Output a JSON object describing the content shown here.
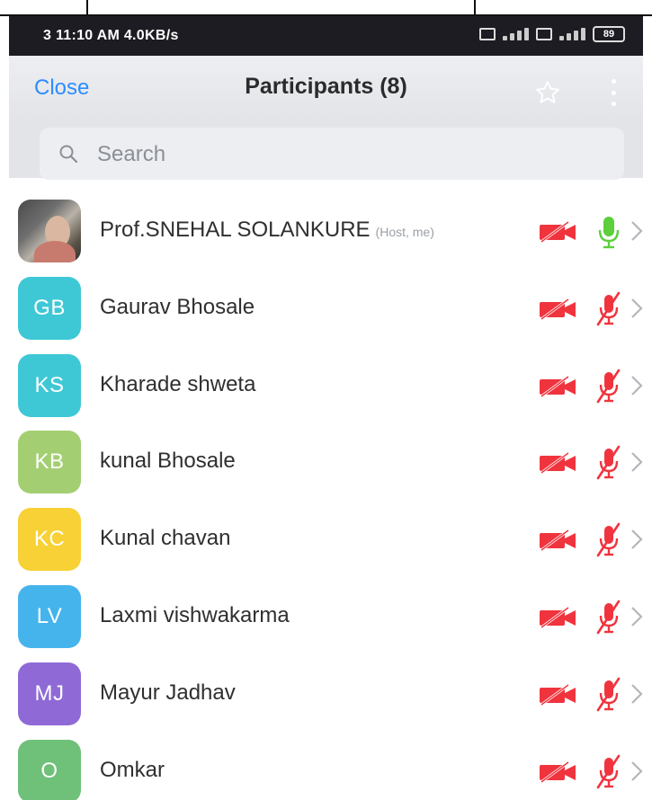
{
  "status_bar": {
    "time_text": "3 11:10 AM 4.0KB/s",
    "battery": "89"
  },
  "header": {
    "close_label": "Close",
    "title": "Participants (8)"
  },
  "search": {
    "placeholder": "Search"
  },
  "participants": [
    {
      "initials": "",
      "name": "Prof.SNEHAL SOLANKURE",
      "role": "(Host, me)",
      "avatar_color": "#555555",
      "video_on": false,
      "mic_on": true
    },
    {
      "initials": "GB",
      "name": "Gaurav Bhosale",
      "role": "",
      "avatar_color": "#3ec8d6",
      "video_on": false,
      "mic_on": false
    },
    {
      "initials": "KS",
      "name": "Kharade shweta",
      "role": "",
      "avatar_color": "#3ec8d6",
      "video_on": false,
      "mic_on": false
    },
    {
      "initials": "KB",
      "name": "kunal Bhosale",
      "role": "",
      "avatar_color": "#a3cf72",
      "video_on": false,
      "mic_on": false
    },
    {
      "initials": "KC",
      "name": "Kunal chavan",
      "role": "",
      "avatar_color": "#f7d135",
      "video_on": false,
      "mic_on": false
    },
    {
      "initials": "LV",
      "name": "Laxmi vishwakarma",
      "role": "",
      "avatar_color": "#46b4ec",
      "video_on": false,
      "mic_on": false
    },
    {
      "initials": "MJ",
      "name": "Mayur Jadhav",
      "role": "",
      "avatar_color": "#8f6ad6",
      "video_on": false,
      "mic_on": false
    },
    {
      "initials": "O",
      "name": "Omkar",
      "role": "",
      "avatar_color": "#6fc079",
      "video_on": false,
      "mic_on": false
    }
  ],
  "colors": {
    "accent": "#2d8cff",
    "muted_red": "#f0343e",
    "mic_on_green": "#5ccf3b"
  },
  "icons": {
    "video_off": "video-off-icon",
    "mic_off": "mic-off-icon",
    "mic_on": "mic-on-icon",
    "chevron": "chevron-right-icon",
    "star": "star-icon",
    "more": "more-vertical-icon",
    "search": "search-icon"
  }
}
